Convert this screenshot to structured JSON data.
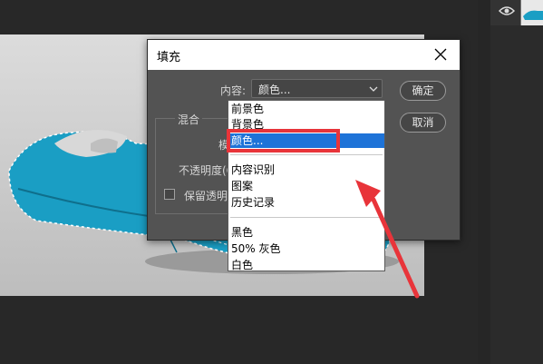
{
  "dialog": {
    "title": "填充",
    "content_label": "内容:",
    "content_value": "颜色...",
    "ok_label": "确定",
    "cancel_label": "取消",
    "blend_group_title": "混合",
    "mode_label": "模式:",
    "opacity_label": "不透明度(O):",
    "preserve_label": "保留透明区域"
  },
  "dropdown": {
    "items": [
      "前景色",
      "背景色",
      "颜色...",
      "内容识别",
      "图案",
      "历史记录",
      "黑色",
      "50% 灰色",
      "白色"
    ],
    "selected": "颜色..."
  },
  "icons": [
    "eye-icon",
    "close-icon",
    "chevron-down-icon"
  ],
  "colors": {
    "accent": "#1e73d8",
    "highlight": "#e8343a",
    "shoe": "#1a9ec4"
  }
}
